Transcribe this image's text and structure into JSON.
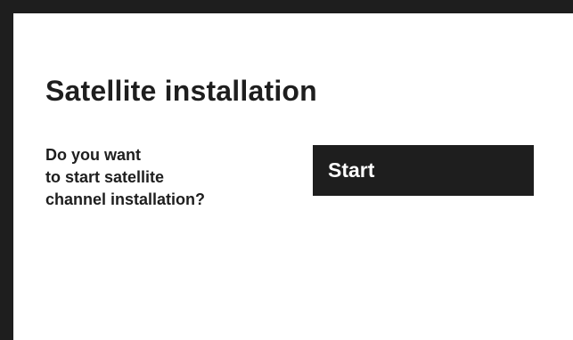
{
  "dialog": {
    "title": "Satellite installation",
    "question_lines": [
      "Do you want",
      "to start satellite",
      "channel installation?"
    ],
    "start_label": "Start"
  },
  "colors": {
    "background": "#ffffff",
    "frame": "#1e1e1e",
    "text": "#1e1e1e",
    "button_bg": "#1e1e1e",
    "button_text": "#ffffff"
  }
}
